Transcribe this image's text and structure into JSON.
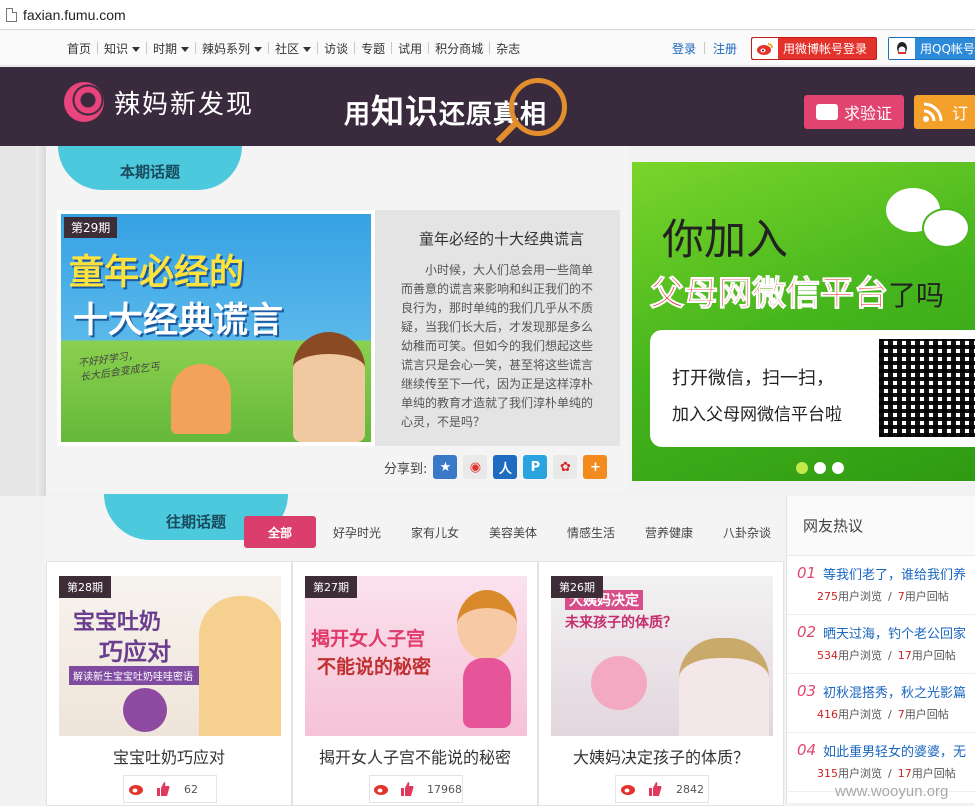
{
  "browser": {
    "url": "faxian.fumu.com"
  },
  "topnav": {
    "items": [
      {
        "label": "首页",
        "dropdown": false
      },
      {
        "label": "知识",
        "dropdown": true
      },
      {
        "label": "时期",
        "dropdown": true
      },
      {
        "label": "辣妈系列",
        "dropdown": true
      },
      {
        "label": "社区",
        "dropdown": true
      },
      {
        "label": "访谈",
        "dropdown": false
      },
      {
        "label": "专题",
        "dropdown": false
      },
      {
        "label": "试用",
        "dropdown": false
      },
      {
        "label": "积分商城",
        "dropdown": false
      },
      {
        "label": "杂志",
        "dropdown": false
      }
    ],
    "login": "登录",
    "register": "注册",
    "weibo_login": "用微博帐号登录",
    "qq_login": "用QQ帐号"
  },
  "banner": {
    "logo_text": "辣妈新发现",
    "slogan_a": "用",
    "slogan_b": "知识",
    "slogan_c": "还原真相",
    "verify_label": "求验证",
    "subscribe_label": "订"
  },
  "current": {
    "badge": "本期话题",
    "issue": "第29期",
    "img_line1": "童年必经的",
    "img_line2": "十大经典谎言",
    "img_scribble": "不好好学习，\n长大后会变成乞丐",
    "title": "童年必经的十大经典谎言",
    "summary": "小时候，大人们总会用一些简单而善意的谎言来影响和纠正我们的不良行为，那时单纯的我们几乎从不质疑，当我们长大后，才发现那是多么幼稚而可笑。但如今的我们想起这些谎言只是会心一笑，甚至将这些谎言继续传至下一代，因为正是这样淳朴单纯的教育才造就了我们淳朴单纯的心灵，不是吗？",
    "share_label": "分享到:"
  },
  "ad": {
    "line1": "你加入",
    "line2": "父母网微信平台",
    "line2_tail": "了吗",
    "card1": "打开微信，扫一扫，",
    "card2": "加入父母网微信平台啦",
    "slides": 3,
    "active_slide": 1
  },
  "past": {
    "badge": "往期话题",
    "categories": [
      {
        "label": "全部",
        "active": true
      },
      {
        "label": "好孕时光",
        "active": false
      },
      {
        "label": "家有儿女",
        "active": false
      },
      {
        "label": "美容美体",
        "active": false
      },
      {
        "label": "情感生活",
        "active": false
      },
      {
        "label": "营养健康",
        "active": false
      },
      {
        "label": "八卦杂谈",
        "active": false
      }
    ],
    "cards": [
      {
        "issue": "第28期",
        "img_a": "宝宝吐奶",
        "img_b": "巧应对",
        "img_c": "解读新生宝宝吐奶哇哇密语",
        "title": "宝宝吐奶巧应对",
        "count": "62"
      },
      {
        "issue": "第27期",
        "img_a": "揭开女人子宫",
        "img_b": "不能说的秘密",
        "img_c": "",
        "title": "揭开女人子宫不能说的秘密",
        "count": "17968"
      },
      {
        "issue": "第26期",
        "img_a": "大姨妈决定",
        "img_b": "未来孩子的体质？",
        "img_c": "",
        "title": "大姨妈决定孩子的体质？",
        "count": "2842"
      }
    ]
  },
  "hot": {
    "title": "网友热议",
    "items": [
      {
        "no": "01",
        "title": "等我们老了，谁给我们养",
        "views": "275",
        "replies": "7"
      },
      {
        "no": "02",
        "title": "晒天过海，钓个老公回家",
        "views": "534",
        "replies": "17"
      },
      {
        "no": "03",
        "title": "初秋混搭秀，秋之光影篇",
        "views": "416",
        "replies": "7"
      },
      {
        "no": "04",
        "title": "如此重男轻女的婆婆，无",
        "views": "315",
        "replies": "17"
      }
    ],
    "views_suffix": "用户浏览",
    "replies_suffix": "用户回帖",
    "divider": "/"
  },
  "watermark": "www.wooyun.org"
}
